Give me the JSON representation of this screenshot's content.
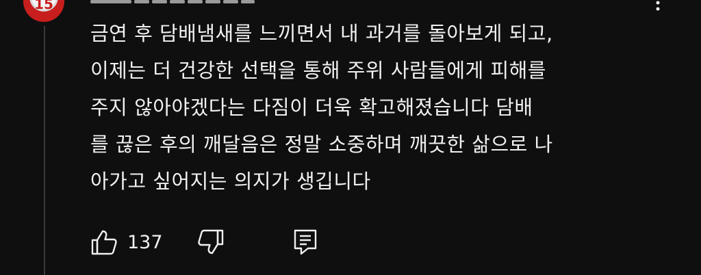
{
  "comment": {
    "avatar_text": "15",
    "lines": [
      "금연 후 담배냄새를 느끼면서 내 과거를 돌아보게 되고,",
      "이제는 더 건강한 선택을 통해 주위 사람들에게 피해를",
      "주지 않아야겠다는 다짐이 더욱 확고해졌습니다  담배",
      "를 끊은 후의 깨달음은 정말 소중하며 깨끗한 삶으로 나",
      "아가고 싶어지는 의지가 생깁니다"
    ],
    "like_count": "137"
  },
  "icons": {
    "like": "thumbs-up-icon",
    "dislike": "thumbs-down-icon",
    "reply": "reply-comment-icon",
    "more": "more-vertical-icon"
  },
  "colors": {
    "background": "#0f0f0f",
    "text": "#f1f1f1",
    "thread_line": "#3a3a3a"
  }
}
